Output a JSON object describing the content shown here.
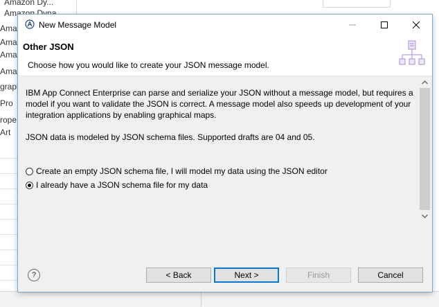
{
  "window": {
    "title": "New Message Model"
  },
  "background": {
    "left_items": [
      "Amazon Dy...",
      "Amazon Dyna",
      "Ama",
      "Ama",
      "Ama",
      "Ama",
      "graph",
      "Pro",
      "rope",
      "Art"
    ]
  },
  "header": {
    "title": "Other JSON",
    "description": "Choose how you would like to create your JSON message model."
  },
  "content": {
    "intro": "IBM App Connect Enterprise can parse and serialize your JSON without a message model, but requires a model if you want to validate the JSON is correct. A message model also speeds up development of your integration applications by enabling graphical maps.",
    "drafts": "JSON data is modeled by JSON schema files. Supported drafts are 04 and 05.",
    "options": [
      {
        "label": "Create an empty JSON schema file, I will model my data using the JSON editor",
        "selected": false
      },
      {
        "label": "I already have a JSON schema file for my data",
        "selected": true
      }
    ]
  },
  "footer": {
    "help": "?",
    "back": "< Back",
    "next": "Next >",
    "finish": "Finish",
    "cancel": "Cancel"
  },
  "icons": {
    "app": "ibm-app-icon",
    "wizard": "message-model-hierarchy-icon",
    "minimize": "minimize-icon",
    "maximize": "maximize-icon",
    "close": "close-icon",
    "scroll_up": "chevron-up-icon",
    "scroll_down": "chevron-down-icon"
  },
  "colors": {
    "accent": "#0078d7",
    "wizard_icon": "#a78bd6"
  }
}
